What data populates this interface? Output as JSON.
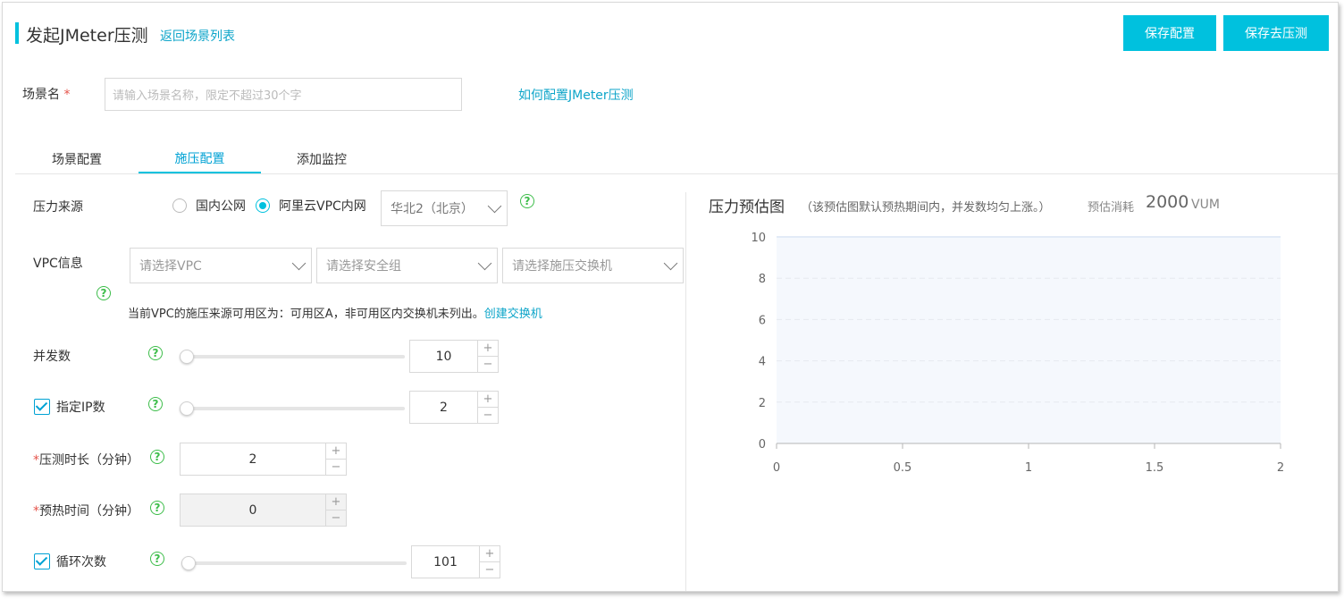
{
  "header": {
    "title": "发起JMeter压测",
    "back_link": "返回场景列表",
    "save_config": "保存配置",
    "save_and_run": "保存去压测"
  },
  "scene": {
    "label": "场景名",
    "required_mark": "*",
    "placeholder": "请输入场景名称，限定不超过30个字",
    "help_link": "如何配置JMeter压测"
  },
  "tabs": [
    {
      "label": "场景配置",
      "active": false
    },
    {
      "label": "施压配置",
      "active": true
    },
    {
      "label": "添加监控",
      "active": false
    }
  ],
  "pressure_source": {
    "label": "压力来源",
    "option_public": "国内公网",
    "option_vpc": "阿里云VPC内网",
    "selected": "option_vpc",
    "region": "华北2（北京）"
  },
  "vpc": {
    "label": "VPC信息",
    "select_vpc": "请选择VPC",
    "select_security_group": "请选择安全组",
    "select_switch": "请选择施压交换机",
    "note": "当前VPC的施压来源可用区为：可用区A，非可用区内交换机未列出。",
    "create_switch_link": "创建交换机"
  },
  "concurrency": {
    "label": "并发数",
    "value": "10",
    "slider_fraction": 0
  },
  "ip_count": {
    "label": "指定IP数",
    "checked": true,
    "value": "2",
    "slider_fraction": 0
  },
  "duration": {
    "required_mark": "*",
    "label": "压测时长（分钟）",
    "value": "2"
  },
  "warmup": {
    "required_mark": "*",
    "label": "预热时间（分钟）",
    "value": "0",
    "disabled": true
  },
  "loops": {
    "label": "循环次数",
    "checked": true,
    "value": "101",
    "slider_fraction": 0
  },
  "stepper": {
    "plus": "+",
    "minus": "−"
  },
  "help_glyph": "?",
  "estimate": {
    "title": "压力预估图",
    "note": "（该预估图默认预热期间内，并发数均匀上涨。）",
    "cost_label": "预估消耗",
    "cost_value": "2000",
    "cost_unit": "VUM"
  },
  "chart_data": {
    "type": "area",
    "x": [
      0,
      2
    ],
    "values": [
      10,
      10
    ],
    "xlim": [
      0,
      2
    ],
    "ylim": [
      0,
      10
    ],
    "x_ticks": [
      "0",
      "0.5",
      "1",
      "1.5",
      "2"
    ],
    "y_ticks": [
      "0",
      "2",
      "4",
      "6",
      "8",
      "10"
    ],
    "fill_color": "#f5f8fd",
    "grid": "dashed horizontal"
  },
  "colors": {
    "accent": "#00c1de",
    "link": "#0ea5c9",
    "help": "#3dbd4a",
    "required": "#e5544b"
  }
}
